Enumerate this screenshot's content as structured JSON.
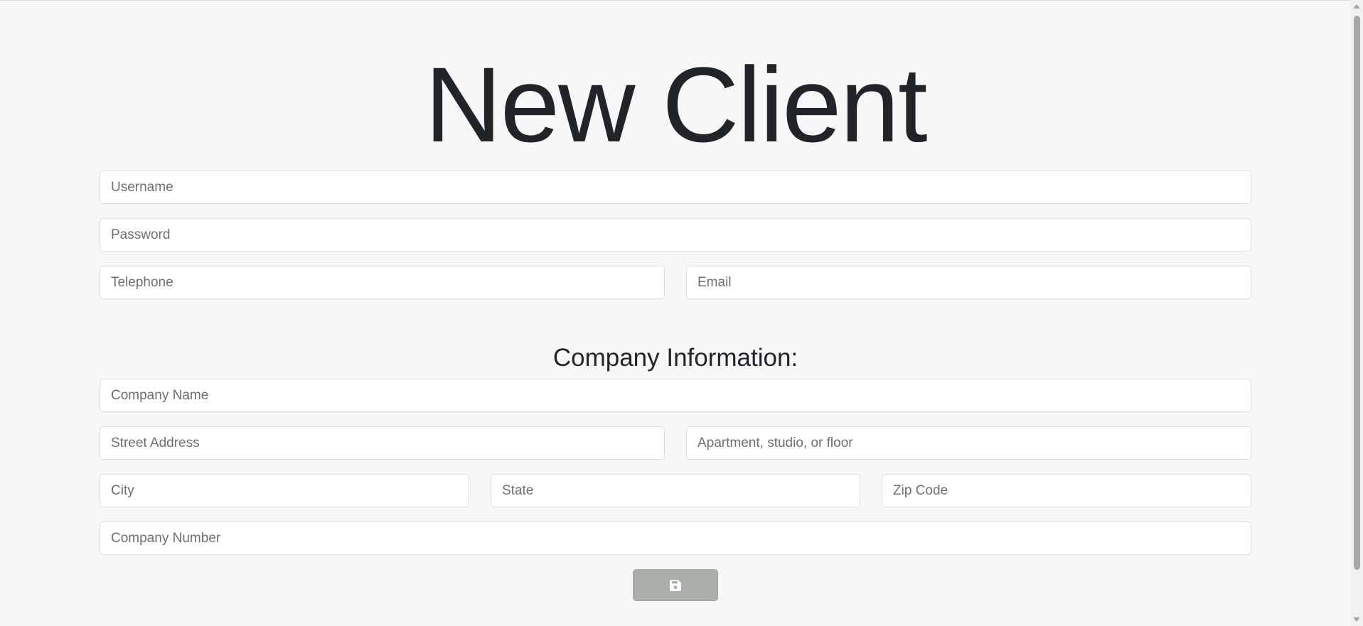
{
  "page": {
    "title": "New Client"
  },
  "account": {
    "username_placeholder": "Username",
    "password_placeholder": "Password",
    "telephone_placeholder": "Telephone",
    "email_placeholder": "Email"
  },
  "company": {
    "section_title": "Company Information:",
    "name_placeholder": "Company Name",
    "street_placeholder": "Street Address",
    "apartment_placeholder": "Apartment, studio, or floor",
    "city_placeholder": "City",
    "state_placeholder": "State",
    "zip_placeholder": "Zip Code",
    "number_placeholder": "Company Number"
  },
  "actions": {
    "save_icon": "floppy-disk-icon"
  },
  "colors": {
    "background": "#f7f7f7",
    "save_button": "#a8afa6",
    "text": "#212529"
  }
}
